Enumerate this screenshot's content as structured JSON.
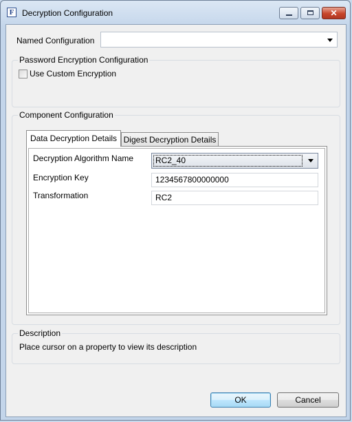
{
  "window": {
    "title": "Decryption Configuration"
  },
  "named_configuration": {
    "label": "Named Configuration",
    "value": ""
  },
  "password_group": {
    "title": "Password Encryption Configuration",
    "use_custom_label": "Use Custom Encryption",
    "use_custom_checked": false
  },
  "component_group": {
    "title": "Component Configuration",
    "tabs": [
      {
        "label": "Data Decryption Details",
        "active": true
      },
      {
        "label": "Digest Decryption Details",
        "active": false
      }
    ],
    "fields": {
      "algorithm": {
        "label": "Decryption Algorithm Name",
        "value": "RC2_40"
      },
      "key": {
        "label": "Encryption Key",
        "value": "1234567800000000"
      },
      "transformation": {
        "label": "Transformation",
        "value": "RC2"
      }
    }
  },
  "description": {
    "title": "Description",
    "text": "Place cursor on a property to view its description"
  },
  "buttons": {
    "ok": "OK",
    "cancel": "Cancel"
  }
}
